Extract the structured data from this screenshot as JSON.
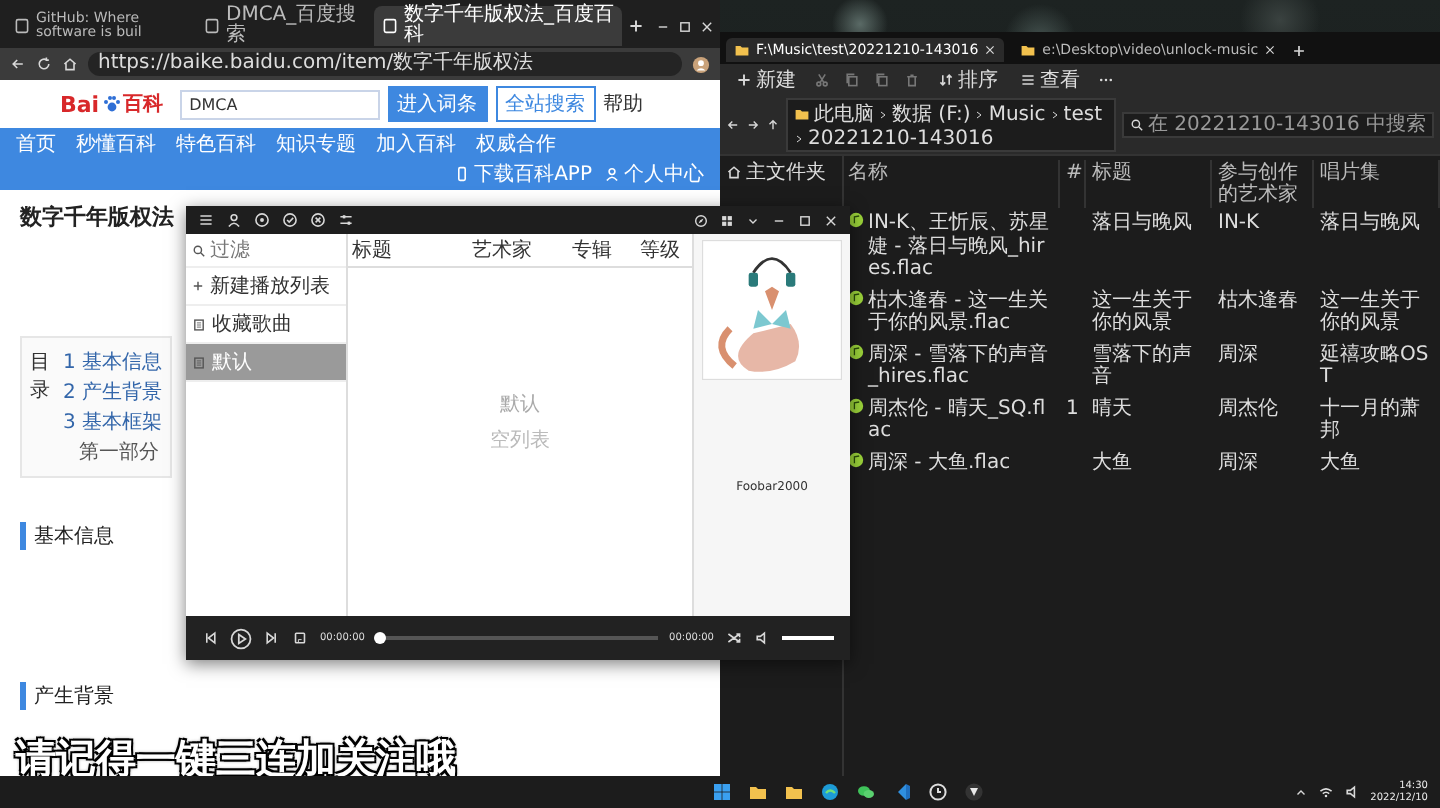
{
  "browser": {
    "tabs": [
      {
        "label": "GitHub: Where software is buil",
        "selected": false
      },
      {
        "label": "DMCA_百度搜索",
        "selected": false
      },
      {
        "label": "数字千年版权法_百度百科",
        "selected": true
      }
    ],
    "address": "https://baike.baidu.com/item/数字千年版权法",
    "page": {
      "logo": {
        "left": "Bai",
        "right": "百科"
      },
      "search_value": "DMCA",
      "buttons": [
        "进入词条",
        "全站搜索"
      ],
      "help": "帮助",
      "nav": [
        "首页",
        "秒懂百科",
        "特色百科",
        "知识专题",
        "加入百科",
        "权威合作"
      ],
      "nav_right": [
        "下载百科APP",
        "个人中心"
      ],
      "title": "数字千年版权法",
      "toc_title": "目录",
      "toc": [
        {
          "label": "1 基本信息"
        },
        {
          "label": "2 产生背景"
        },
        {
          "label": "3 基本框架",
          "children": [
            {
              "label": "第一部分"
            }
          ]
        }
      ],
      "sections": [
        "基本信息",
        "产生背景"
      ]
    }
  },
  "player": {
    "search_placeholder": "过滤",
    "new_playlist": "新建播放列表",
    "playlists": [
      {
        "label": "收藏歌曲",
        "selected": false
      },
      {
        "label": "默认",
        "selected": true
      }
    ],
    "columns": [
      "标题",
      "艺术家",
      "专辑",
      "等级"
    ],
    "empty_title": "默认",
    "empty_note": "空列表",
    "art_caption": "Foobar2000",
    "time_elapsed": "00:00:00",
    "time_total": "00:00:00",
    "seek": {
      "level": 0
    },
    "volume": {
      "level": 1
    }
  },
  "explorer": {
    "tabs": [
      {
        "label": "F:\\Music\\test\\20221210-143016",
        "selected": true
      },
      {
        "label": "e:\\Desktop\\video\\unlock-music",
        "selected": false
      }
    ],
    "toolbar": [
      "新建",
      "排序",
      "查看"
    ],
    "breadcrumbs": [
      "此电脑",
      "数据 (F:)",
      "Music",
      "test",
      "20221210-143016"
    ],
    "search_placeholder": "在 20221210-143016 中搜索",
    "sidebar": [
      "主文件夹"
    ],
    "columns": [
      "名称",
      "#",
      "标题",
      "参与创作的艺术家",
      "唱片集"
    ],
    "rows": [
      {
        "name": "IN-K、王忻辰、苏星婕 - 落日与晚风_hires.flac",
        "number": "",
        "title": "落日与晚风",
        "artist": "IN-K",
        "album": "落日与晚风"
      },
      {
        "name": "枯木逢春 - 这一生关于你的风景.flac",
        "number": "",
        "title": "这一生关于你的风景",
        "artist": "枯木逢春",
        "album": "这一生关于你的风景"
      },
      {
        "name": "周深 - 雪落下的声音_hires.flac",
        "number": "",
        "title": "雪落下的声音",
        "artist": "周深",
        "album": "延禧攻略OST"
      },
      {
        "name": "周杰伦 - 晴天_SQ.flac",
        "number": "1",
        "title": "晴天",
        "artist": "周杰伦",
        "album": "十一月的萧邦"
      },
      {
        "name": "周深 - 大鱼.flac",
        "number": "",
        "title": "大鱼",
        "artist": "周深",
        "album": "大鱼"
      }
    ]
  },
  "subtitle": "请记得一键三连加关注哦",
  "taskbar": {
    "time": "14:30",
    "date": "2022/12/10"
  }
}
